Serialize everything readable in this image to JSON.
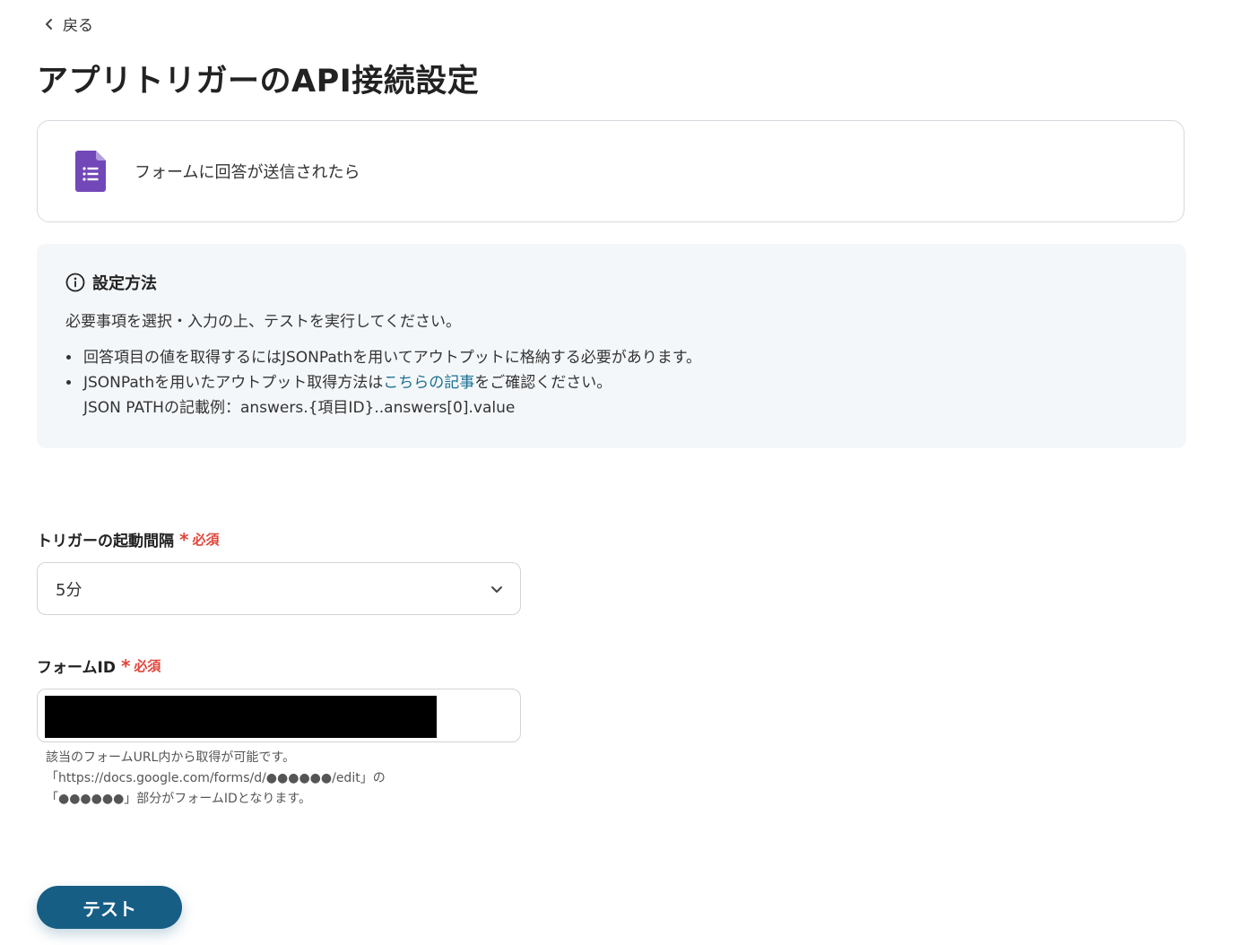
{
  "nav": {
    "back_label": "戻る"
  },
  "page": {
    "title": "アプリトリガーのAPI接続設定"
  },
  "app_card": {
    "icon": "google-forms-icon",
    "label": "フォームに回答が送信されたら"
  },
  "info": {
    "heading": "設定方法",
    "description": "必要事項を選択・入力の上、テストを実行してください。",
    "bullet1": "回答項目の値を取得するにはJSONPathを用いてアウトプットに格納する必要があります。",
    "bullet2_prefix": "JSONPathを用いたアウトプット取得方法は",
    "bullet2_link": "こちらの記事",
    "bullet2_suffix": "をご確認ください。",
    "bullet2_example": "JSON PATHの記載例：answers.{項目ID}..answers[0].value"
  },
  "fields": {
    "interval": {
      "label": "トリガーの起動間隔",
      "required": "必須",
      "value": "5分"
    },
    "form_id": {
      "label": "フォームID",
      "required": "必須",
      "hint1": "該当のフォームURL内から取得が可能です。",
      "hint2": "「https://docs.google.com/forms/d/●●●●●●/edit」の",
      "hint3": "「●●●●●●」部分がフォームIDとなります。"
    }
  },
  "actions": {
    "test_label": "テスト"
  },
  "colors": {
    "accent": "#175e85",
    "link": "#1b6f92",
    "required": "#e0453a",
    "forms_purple": "#7248b9"
  }
}
